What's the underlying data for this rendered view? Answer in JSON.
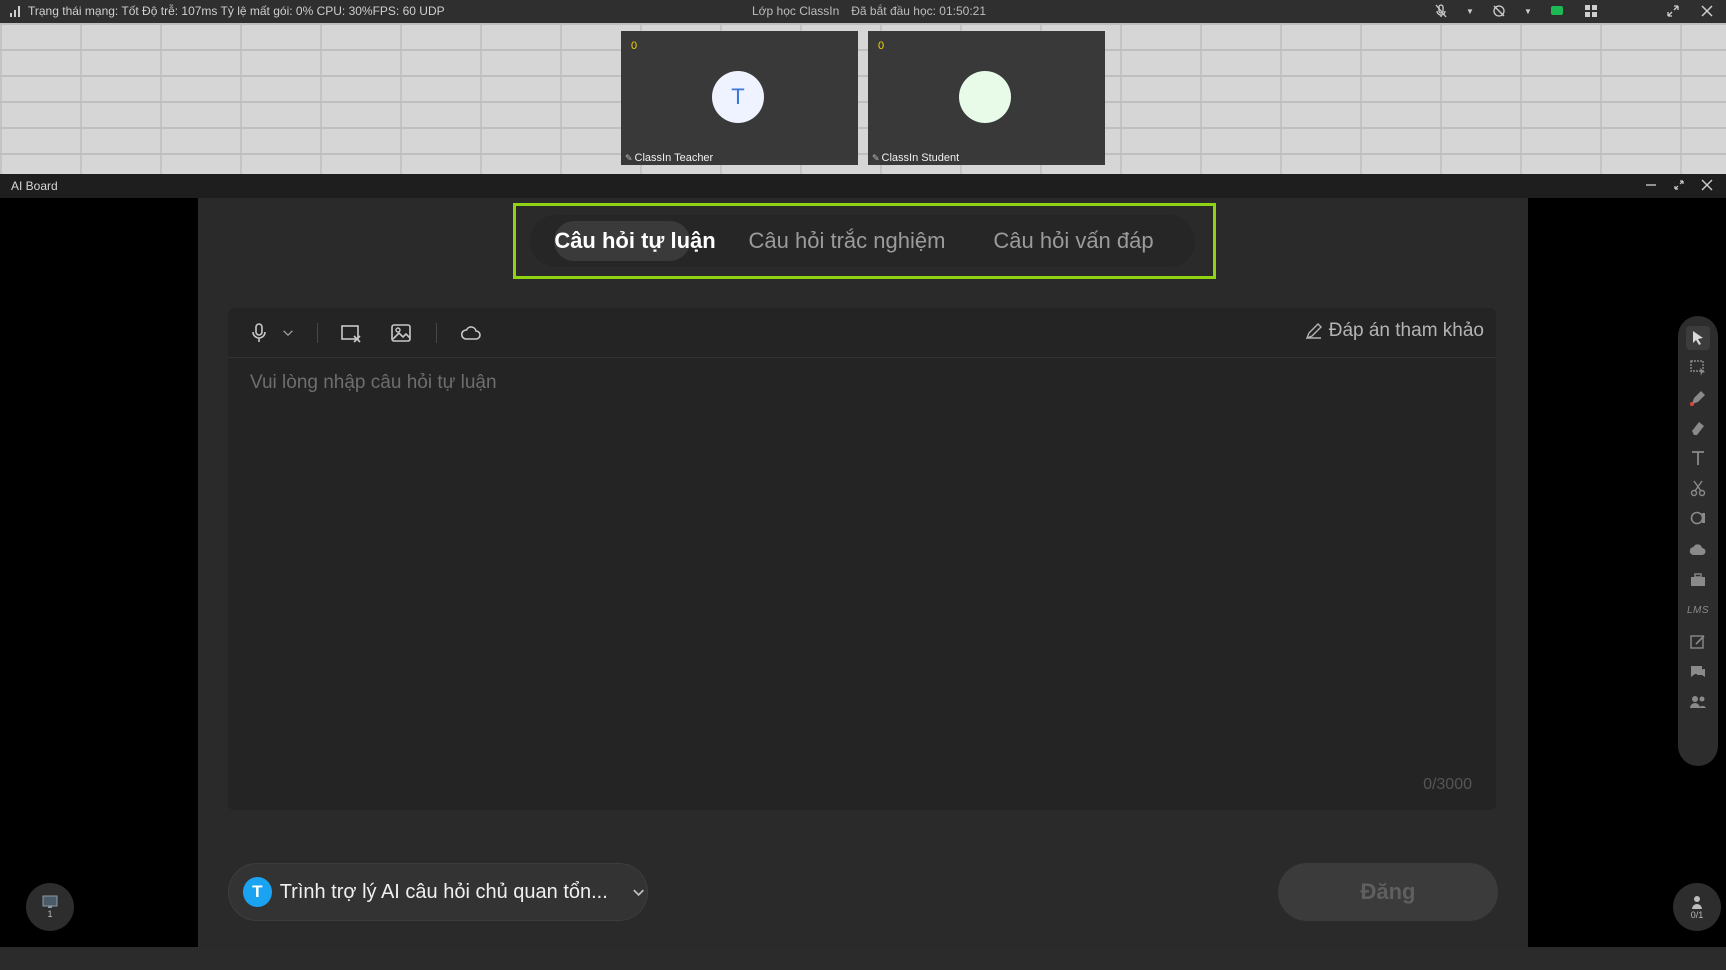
{
  "topbar": {
    "status_text": "Trạng thái mạng: Tốt Độ trễ: 107ms Tỷ lệ mất gói: 0%  CPU: 30%FPS: 60 UDP",
    "class_name": "Lớp học ClassIn",
    "elapsed": "Đã bắt đầu học: 01:50:21"
  },
  "videos": [
    {
      "count": "0",
      "initial": "T",
      "name": "ClassIn Teacher",
      "avatar_bg": "#eef3ff",
      "avatar_color": "#3b78d8"
    },
    {
      "count": "0",
      "initial": "",
      "name": "ClassIn Student",
      "avatar_bg": "#e8fbe8",
      "avatar_color": "#3b78d8"
    }
  ],
  "board": {
    "title": "AI Board",
    "tabs": [
      {
        "label": "Câu hỏi tự luận",
        "active": true
      },
      {
        "label": "Câu hỏi trắc nghiệm",
        "active": false
      },
      {
        "label": "Câu hỏi vấn đáp",
        "active": false
      }
    ],
    "editor": {
      "reference_answer": "Đáp án tham khảo",
      "placeholder": "Vui lòng nhập câu hỏi tự luận",
      "counter": "0/3000"
    },
    "assistant": {
      "avatar_letter": "T",
      "label": "Trình trợ lý AI câu hỏi chủ quan tổn..."
    },
    "post_label": "Đăng",
    "left_corner_count": "1",
    "right_corner_count": "0/1",
    "side_tools": {
      "lms_label": "LMS"
    }
  },
  "colors": {
    "highlight": "#8ed414",
    "assistant_avatar": "#1aa3f0",
    "count_color": "#f6d600"
  }
}
